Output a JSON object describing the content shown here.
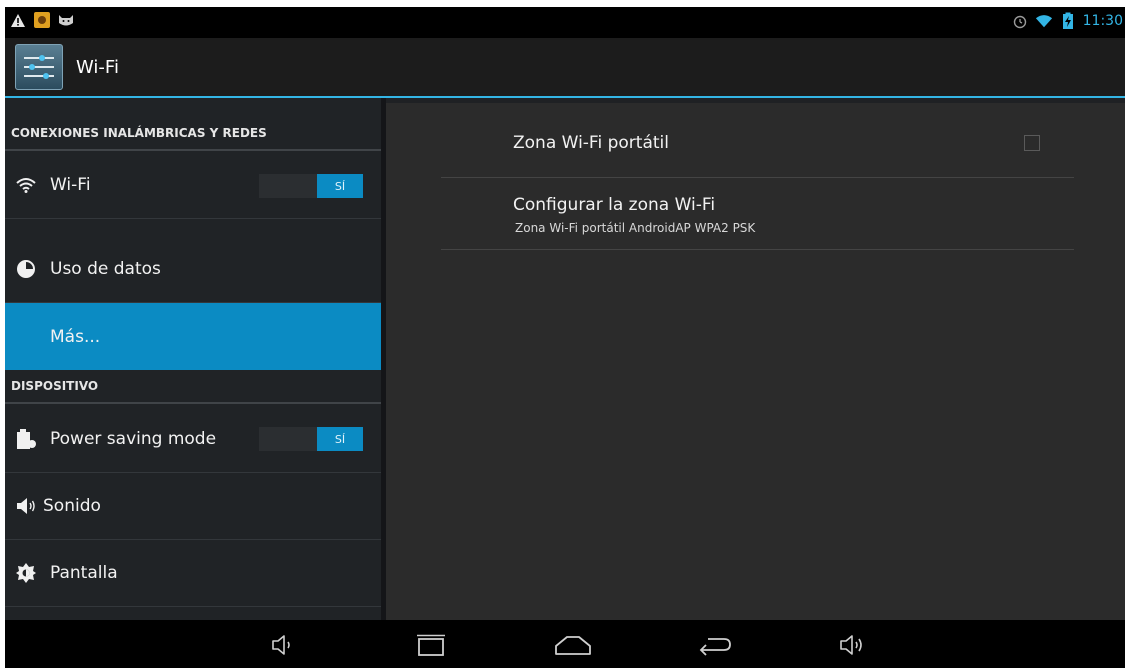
{
  "status_bar": {
    "left_icons": [
      "warning-icon",
      "notification-app-icon",
      "android-cat-icon"
    ],
    "right_icons": [
      "alarm-icon",
      "wifi-signal-icon",
      "battery-charging-icon"
    ],
    "time": "11:30"
  },
  "action_bar": {
    "title": "Wi-Fi",
    "icon": "settings-app-icon"
  },
  "left_pane": {
    "sections": [
      {
        "header": "CONEXIONES INALÁMBRICAS Y REDES"
      },
      {
        "header": "DISPOSITIVO"
      }
    ],
    "items": [
      {
        "label": "Wi-Fi",
        "icon": "wifi-icon",
        "toggle": "SÍ"
      },
      {
        "label": "Uso de datos",
        "icon": "data-usage-icon"
      },
      {
        "label": "Más...",
        "selected": true
      },
      {
        "label": "Power saving mode",
        "icon": "battery-saver-icon",
        "toggle": "SÍ"
      },
      {
        "label": "Sonido",
        "icon": "sound-icon"
      },
      {
        "label": "Pantalla",
        "icon": "display-icon"
      }
    ]
  },
  "right_pane": {
    "items": [
      {
        "title": "Zona Wi-Fi portátil",
        "checked": false
      },
      {
        "title": "Configurar la zona Wi-Fi",
        "subtitle": "Zona Wi-Fi portátil AndroidAP WPA2 PSK"
      }
    ]
  },
  "nav_bar": {
    "buttons": [
      "volume-down-icon",
      "recent-apps-icon",
      "home-icon",
      "back-icon",
      "volume-up-icon"
    ]
  },
  "colors": {
    "accent": "#33b5e5",
    "selected": "#0b8bc3",
    "background": "#1f2124"
  }
}
